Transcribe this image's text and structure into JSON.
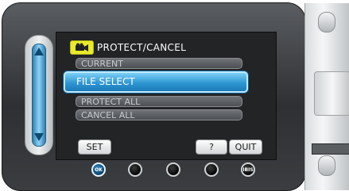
{
  "screen": {
    "title": "PROTECT/CANCEL",
    "menu": [
      {
        "label": "CURRENT",
        "selected": false
      },
      {
        "label": "FILE SELECT",
        "selected": true
      },
      {
        "label": "PROTECT ALL",
        "selected": false
      },
      {
        "label": "CANCEL ALL",
        "selected": false
      }
    ],
    "buttons": {
      "set": "SET",
      "help": "?",
      "quit": "QUIT"
    }
  },
  "hardware": {
    "ok_label": "OK",
    "ibis_label": "IBIS"
  },
  "colors": {
    "accent": "#2e97d2",
    "title_icon": "#e9ea2a",
    "menu_bg": "#4b4e52"
  }
}
